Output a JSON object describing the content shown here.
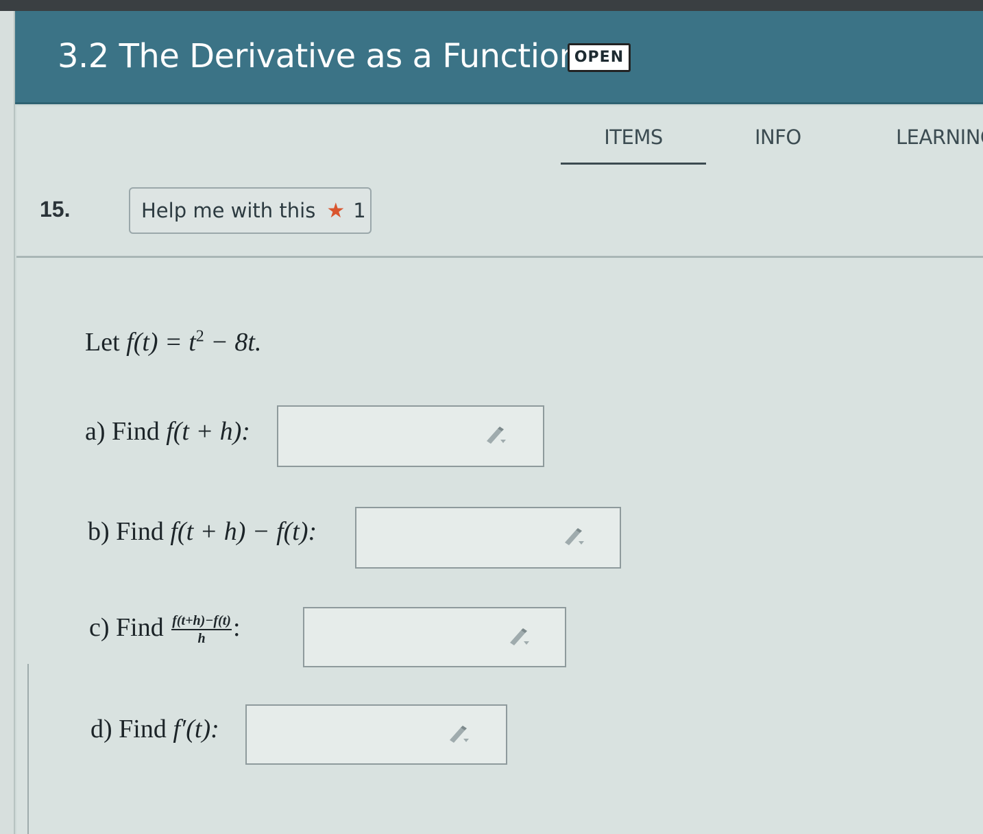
{
  "header": {
    "title": "3.2 The Derivative as a Function",
    "badge": "OPEN"
  },
  "tabs": [
    {
      "label": "ITEMS",
      "active": true
    },
    {
      "label": "INFO",
      "active": false
    },
    {
      "label": "LEARNING",
      "active": false
    }
  ],
  "question": {
    "number": "15.",
    "help_label": "Help me with this",
    "help_count": "1",
    "statement": {
      "prefix": "Let ",
      "func": "f(t) = t",
      "exp": "2",
      "rest": " − 8t."
    },
    "parts": [
      {
        "label": "a) Find ",
        "expr": "f(t + h):",
        "value": ""
      },
      {
        "label": "b) Find ",
        "expr": "f(t + h) − f(t):",
        "value": ""
      },
      {
        "label": "c) Find ",
        "num": "f(t+h)−f(t)",
        "den": "h",
        "suffix": ":",
        "value": ""
      },
      {
        "label": "d) Find ",
        "expr": "f′(t):",
        "value": ""
      }
    ]
  },
  "icons": {
    "answer_tool": "pencil-icon",
    "help_star": "star-icon"
  },
  "colors": {
    "header_bg": "#3b7386",
    "star": "#d9552e"
  }
}
